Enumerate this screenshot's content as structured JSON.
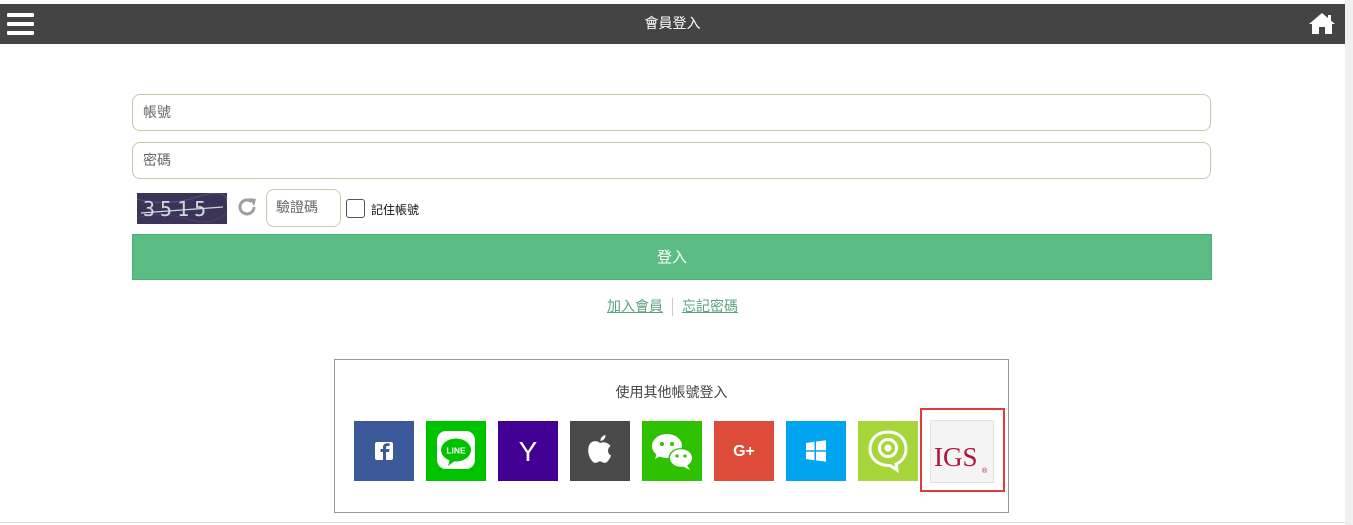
{
  "header": {
    "title": "會員登入",
    "menu_icon": "hamburger-menu-icon",
    "home_icon": "home-icon"
  },
  "form": {
    "account_placeholder": "帳號",
    "password_placeholder": "密碼",
    "captcha_text": "3515",
    "captcha_placeholder": "驗證碼",
    "remember_label": "記住帳號",
    "login_label": "登入"
  },
  "links": {
    "join": "加入會員",
    "forgot": "忘記密碼"
  },
  "social": {
    "title": "使用其他帳號登入",
    "providers": [
      {
        "name": "Facebook",
        "icon": "facebook-icon",
        "color": "#3b5998"
      },
      {
        "name": "LINE",
        "icon": "line-icon",
        "color": "#00c300",
        "label": "LINE"
      },
      {
        "name": "Yahoo",
        "icon": "yahoo-icon",
        "color": "#410093",
        "label": "Y"
      },
      {
        "name": "Apple",
        "icon": "apple-icon",
        "color": "#4a4a4a"
      },
      {
        "name": "WeChat",
        "icon": "wechat-icon",
        "color": "#2dc100"
      },
      {
        "name": "Google+",
        "icon": "google-plus-icon",
        "color": "#dd4b39",
        "label": "G+"
      },
      {
        "name": "Windows",
        "icon": "windows-icon",
        "color": "#00a4ef"
      },
      {
        "name": "Other",
        "icon": "camera-bubble-icon",
        "color": "#a6d63a"
      },
      {
        "name": "IGS",
        "icon": "igs-logo",
        "color": "#b3123c",
        "label": "IGS"
      }
    ]
  },
  "colors": {
    "topbar": "#444444",
    "accent": "#5cbd84",
    "link": "#5aa37e"
  }
}
